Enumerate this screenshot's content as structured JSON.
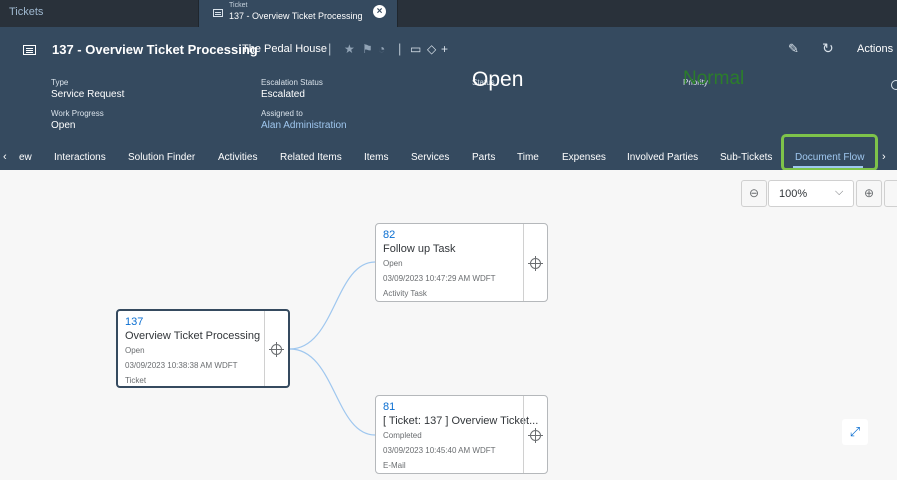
{
  "topbar": {
    "app_tab": "Tickets",
    "doc_tab_small": "Ticket",
    "doc_tab_title": "137 - Overview Ticket Processing"
  },
  "header": {
    "title": "137 - Overview Ticket Processing",
    "account": "The Pedal House",
    "actions_label": "Actions",
    "fields": {
      "type_label": "Type",
      "type_value": "Service Request",
      "work_progress_label": "Work Progress",
      "work_progress_value": "Open",
      "escalation_label": "Escalation Status",
      "escalation_value": "Escalated",
      "assigned_label": "Assigned to",
      "assigned_value": "Alan Administration",
      "status_label": "Status",
      "status_value": "Open",
      "priority_label": "Priority",
      "priority_value": "Normal"
    },
    "colors": {
      "header_bg": "#354a5f",
      "priority": "#2b7d2b",
      "link": "#9fc7ef"
    }
  },
  "tabs": {
    "items": [
      "ew",
      "Interactions",
      "Solution Finder",
      "Activities",
      "Related Items",
      "Items",
      "Services",
      "Parts",
      "Time",
      "Expenses",
      "Involved Parties",
      "Sub-Tickets",
      "Document Flow"
    ],
    "selected": "Document Flow",
    "highlight_color": "#7ec34a"
  },
  "zoom": {
    "value": "100%"
  },
  "flow": {
    "root": {
      "id": "137",
      "title": "Overview Ticket Processing",
      "status": "Open",
      "date": "03/09/2023 10:38:38 AM WDFT",
      "type": "Ticket"
    },
    "children": [
      {
        "id": "82",
        "title": "Follow up Task",
        "status": "Open",
        "date": "03/09/2023 10:47:29 AM WDFT",
        "type": "Activity Task"
      },
      {
        "id": "81",
        "title": "[ Ticket: 137 ] Overview Ticket...",
        "status": "Completed",
        "date": "03/09/2023 10:45:40 AM WDFT",
        "type": "E-Mail"
      }
    ]
  }
}
